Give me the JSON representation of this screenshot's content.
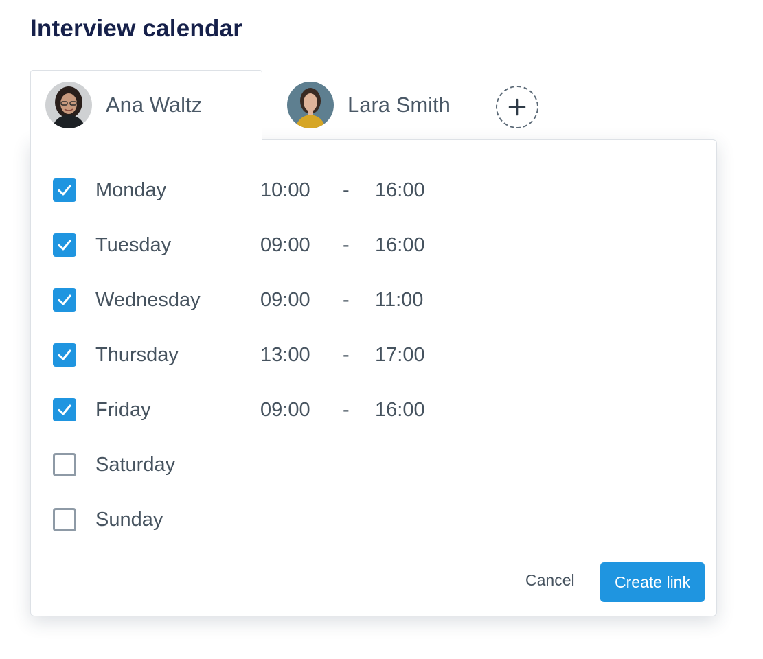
{
  "page": {
    "title": "Interview calendar"
  },
  "tabs": [
    {
      "name": "Ana Waltz",
      "active": true,
      "avatar": "avatar-ana-waltz"
    },
    {
      "name": "Lara Smith",
      "active": false,
      "avatar": "avatar-lara-smith"
    }
  ],
  "add_tab": {
    "icon": "plus-icon"
  },
  "schedule": [
    {
      "day": "Monday",
      "checked": true,
      "start": "10:00",
      "dash": "-",
      "end": "16:00"
    },
    {
      "day": "Tuesday",
      "checked": true,
      "start": "09:00",
      "dash": "-",
      "end": "16:00"
    },
    {
      "day": "Wednesday",
      "checked": true,
      "start": "09:00",
      "dash": "-",
      "end": "11:00"
    },
    {
      "day": "Thursday",
      "checked": true,
      "start": "13:00",
      "dash": "-",
      "end": "17:00"
    },
    {
      "day": "Friday",
      "checked": true,
      "start": "09:00",
      "dash": "-",
      "end": "16:00"
    },
    {
      "day": "Saturday",
      "checked": false
    },
    {
      "day": "Sunday",
      "checked": false
    }
  ],
  "footer": {
    "cancel_label": "Cancel",
    "create_label": "Create link"
  },
  "colors": {
    "accent": "#1f95e0",
    "title": "#16204a",
    "text": "#46535f",
    "border": "#dde1e6"
  }
}
